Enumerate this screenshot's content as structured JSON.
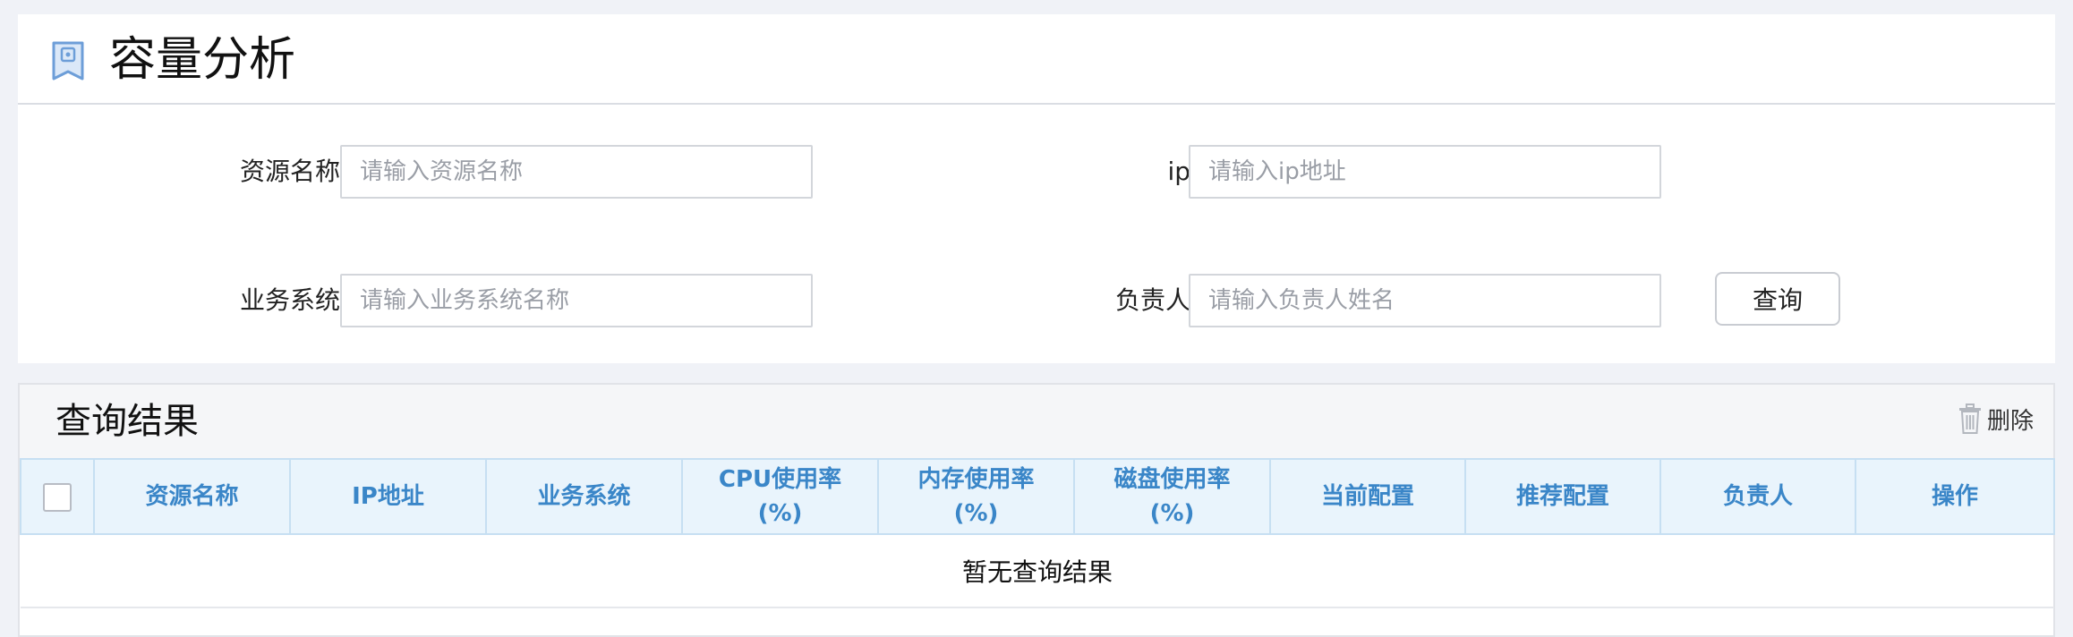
{
  "page": {
    "title": "容量分析"
  },
  "search_form": {
    "resource_name": {
      "label": "资源名称",
      "placeholder": "请输入资源名称",
      "value": ""
    },
    "ip": {
      "label": "ip",
      "placeholder": "请输入ip地址",
      "value": ""
    },
    "business_system": {
      "label": "业务系统",
      "placeholder": "请输入业务系统名称",
      "value": ""
    },
    "owner": {
      "label": "负责人",
      "placeholder": "请输入负责人姓名",
      "value": ""
    },
    "query_button": "查询"
  },
  "results": {
    "title": "查询结果",
    "delete_label": "删除",
    "columns": [
      {
        "line1": "资源名称",
        "line2": ""
      },
      {
        "line1": "IP地址",
        "line2": ""
      },
      {
        "line1": "业务系统",
        "line2": ""
      },
      {
        "line1": "CPU使用率",
        "line2": "(%)"
      },
      {
        "line1": "内存使用率",
        "line2": "(%)"
      },
      {
        "line1": "磁盘使用率",
        "line2": "(%)"
      },
      {
        "line1": "当前配置",
        "line2": ""
      },
      {
        "line1": "推荐配置",
        "line2": ""
      },
      {
        "line1": "负责人",
        "line2": ""
      },
      {
        "line1": "操作",
        "line2": ""
      }
    ],
    "empty_text": "暂无查询结果"
  },
  "colors": {
    "accent": "#3a86c8",
    "header_bg": "#e9f4fc",
    "page_bg": "#f0f2f7"
  },
  "icons": {
    "title": "bookmark-icon",
    "delete": "trash-icon"
  }
}
